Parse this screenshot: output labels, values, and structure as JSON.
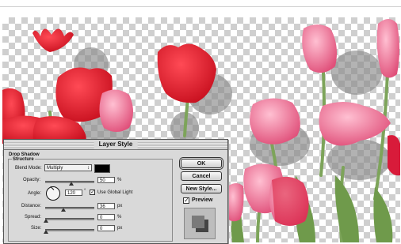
{
  "dialog": {
    "title": "Layer Style",
    "section_title": "Drop Shadow",
    "group_title": "Structure",
    "blend_mode": {
      "label": "Blend Mode:",
      "value": "Multiply",
      "arrow": "↕"
    },
    "opacity": {
      "label": "Opacity:",
      "value": "50",
      "unit": "%"
    },
    "angle": {
      "label": "Angle:",
      "value": "120",
      "unit": "°"
    },
    "global_light": {
      "label": "Use Global Light",
      "checked": true
    },
    "distance": {
      "label": "Distance:",
      "value": "36",
      "unit": "px"
    },
    "spread": {
      "label": "Spread:",
      "value": "0",
      "unit": "%"
    },
    "size": {
      "label": "Size:",
      "value": "0",
      "unit": "px"
    },
    "buttons": {
      "ok": "OK",
      "cancel": "Cancel",
      "new_style": "New Style..."
    },
    "preview": {
      "label": "Preview",
      "checked": true
    },
    "check_glyph": "✓"
  },
  "colors": {
    "shadow_swatch": "#000000",
    "tulip_red": "#e0182b",
    "tulip_pink": "#ec6f93",
    "stem_green": "#7da45a"
  }
}
